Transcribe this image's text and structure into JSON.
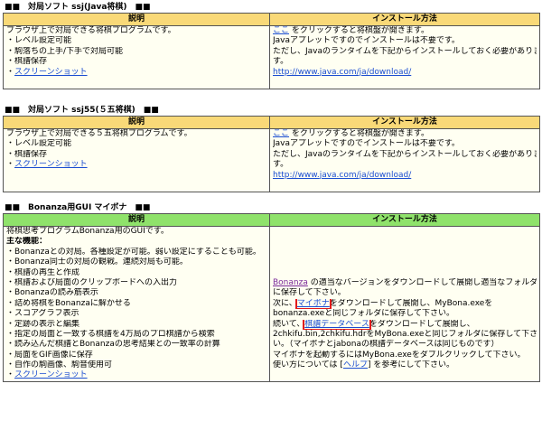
{
  "colors": {
    "yellow_header": "#f9d978",
    "green_header": "#8fe26b",
    "cell_bg": "#fffff2",
    "link": "#1a4dd1",
    "visited_link": "#7a2a9a",
    "highlight_box": "#e21b1b"
  },
  "sections": [
    {
      "title": "■■　対局ソフト ssj(Java将棋)　■■",
      "col_desc": "説明",
      "col_install": "インストール方法",
      "desc_lines": [
        "ブラウザ上で対局できる将棋プログラムです。",
        "・レベル設定可能",
        "・駒落ちの上手/下手で対局可能",
        "・棋譜保存"
      ],
      "screenshot_bullet": "・",
      "screenshot_link": "スクリーンショット",
      "install_link_here": "ここ",
      "install_line1_rest": " をクリックすると将棋盤が開きます。",
      "install_line2": "Javaアプレットですのでインストールは不要です。",
      "install_line3": "ただし、Javaのランタイムを下記からインストールしておく必要がありま",
      "install_line4": "す。",
      "java_url": "http://www.java.com/ja/download/"
    },
    {
      "title": "■■　対局ソフト ssj55(５五将棋)　■■",
      "col_desc": "説明",
      "col_install": "インストール方法",
      "desc_lines": [
        "ブラウザ上で対局できる５五将棋プログラムです。",
        "・レベル設定可能",
        "・棋譜保存"
      ],
      "screenshot_bullet": "・",
      "screenshot_link": "スクリーンショット",
      "install_link_here": "ここ",
      "install_line1_rest": " をクリックすると将棋盤が開きます。",
      "install_line2": "Javaアプレットですのでインストールは不要です。",
      "install_line3": "ただし、Javaのランタイムを下記からインストールしておく必要がありま",
      "install_line4": "す。",
      "java_url": "http://www.java.com/ja/download/"
    }
  ],
  "bonanza": {
    "title": "■■　Bonanza用GUI マイボナ　■■",
    "col_desc": "説明",
    "col_install": "インストール方法",
    "intro": "将棋思考プログラムBonanza用のGUIです。",
    "features_label": "主な機能：",
    "features": [
      "・Bonanzaとの対局。各種設定が可能。弱い設定にすることも可能。",
      "・Bonanza同士の対局の観戦。連続対局も可能。",
      "・棋譜の再生と作成",
      "・棋譜および局面のクリップボードへの入出力",
      "・Bonanzaの読み筋表示",
      "・詰め将棋をBonanzaに解かせる",
      "・スコアグラフ表示",
      "・定跡の表示と編集",
      "・指定の局面と一致する棋譜を4万局のプロ棋譜から検索",
      "・読み込んだ棋譜とBonanzaの思考結果との一致率の計算",
      "・局面をGIF画像に保存",
      "・自作の駒画像、駒音使用可"
    ],
    "screenshot_bullet": "・",
    "screenshot_link": "スクリーンショット",
    "inst_bonanza_link": "Bonanza",
    "inst_l1_rest": " の適当なバージョンをダウンロードして展開し適当なフォルダ",
    "inst_l2": "に保存して下さい。",
    "inst_l3_pre": "次に、",
    "inst_mybona_link": "マイボナ",
    "inst_l3_rest": "をダウンロードして展開し、MyBona.exeを",
    "inst_l4": "bonanza.exeと同じフォルダに保存して下さい。",
    "inst_l5_pre": "続いて、",
    "inst_kifu_link": "棋譜データベース",
    "inst_l5_rest": "をダウンロードして展開し、",
    "inst_l6": "2chkifu.bin,2chkifu.hdrをMyBona.exeと同じフォルダに保存して下さ",
    "inst_l7": "い。（マイボナとjabonaの棋譜データベースは同じものです）",
    "inst_l8": "マイボナを起動するにはMyBona.exeをダブルクリックして下さい。",
    "inst_l9_pre": "使い方については [",
    "inst_help_link": "ヘルプ",
    "inst_l9_rest": "] を参考にして下さい。"
  }
}
